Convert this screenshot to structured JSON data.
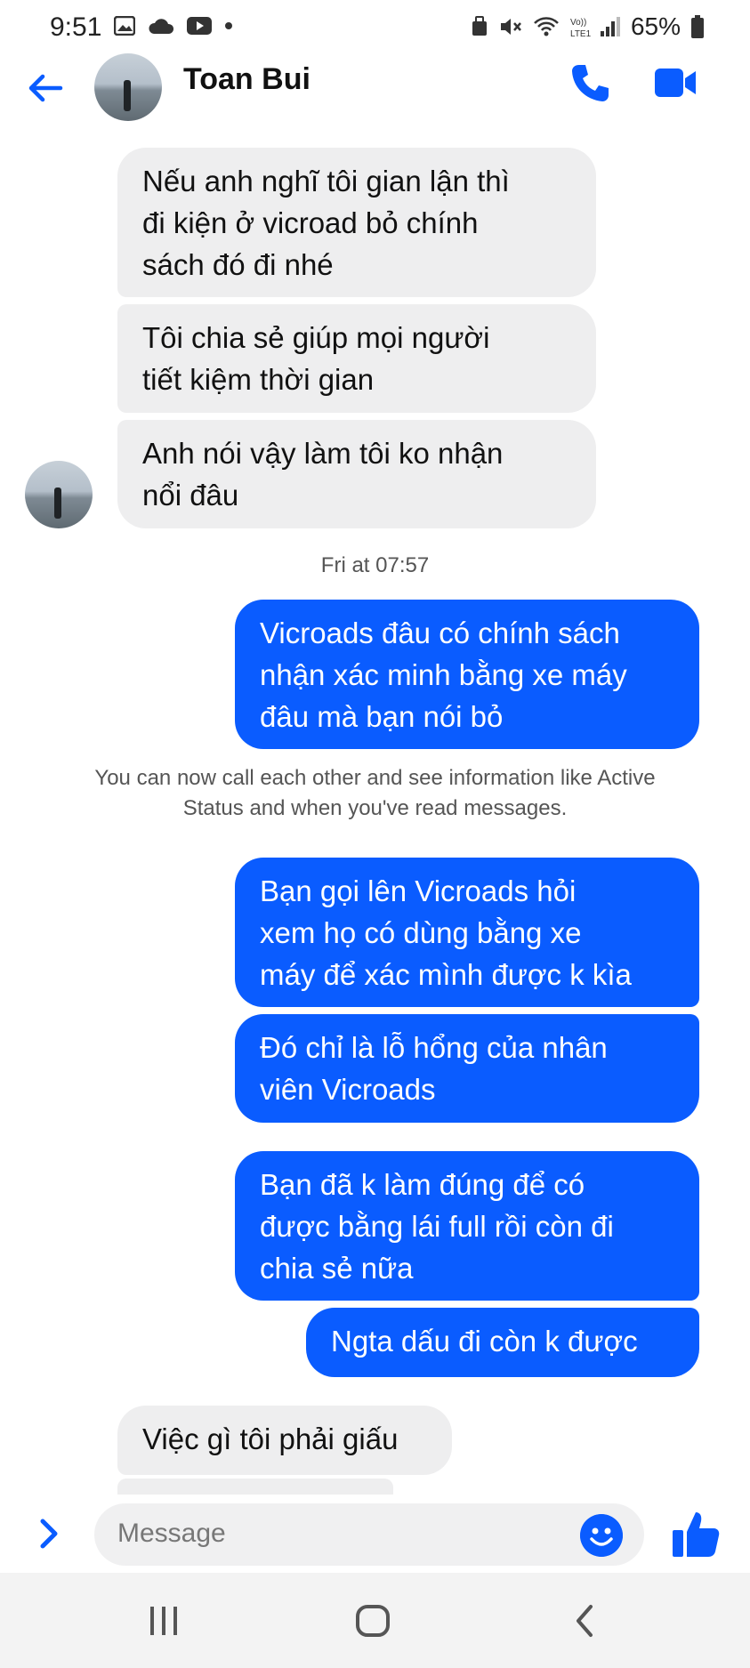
{
  "status_bar": {
    "time": "9:51",
    "battery": "65%"
  },
  "contact": {
    "name": "Toan Bui"
  },
  "messages": [
    {
      "dir": "in",
      "lines": [
        "Nếu anh nghĩ tôi gian lận thì",
        "đi kiện ở vicroad bỏ chính",
        "sách đó đi nhé"
      ]
    },
    {
      "dir": "in",
      "lines": [
        "Tôi chia sẻ giúp mọi người",
        "tiết kiệm thời gian"
      ]
    },
    {
      "dir": "in",
      "lines": [
        "Anh nói vậy làm tôi ko nhận",
        "nổi đâu"
      ]
    },
    {
      "dir": "out",
      "lines": [
        "Vicroads đâu có chính sách",
        "nhận xác minh bằng xe máy",
        "đâu mà bạn nói bỏ"
      ]
    },
    {
      "dir": "out",
      "lines": [
        "Bạn gọi lên Vicroads hỏi",
        "xem họ có dùng bằng xe",
        "máy để xác mình được k kìa"
      ]
    },
    {
      "dir": "out",
      "lines": [
        "Đó chỉ là lỗ hổng của nhân",
        "viên Vicroads"
      ]
    },
    {
      "dir": "out",
      "lines": [
        "Bạn đã k làm đúng để có",
        "được bằng lái full rồi còn đi",
        "chia sẻ nữa"
      ]
    },
    {
      "dir": "out",
      "lines": [
        "Ngta dấu đi còn k được"
      ]
    },
    {
      "dir": "in",
      "lines": [
        "Việc gì tôi phải giấu"
      ]
    }
  ],
  "timestamp": "Fri at 07:57",
  "notice": [
    "You can now call each other and see information like Active",
    "Status and when you've read messages."
  ],
  "composer": {
    "placeholder": "Message"
  },
  "colors": {
    "accent": "#0a5cff",
    "incoming": "#eeeeef"
  },
  "icons": [
    "back-arrow-icon",
    "phone-icon",
    "video-icon",
    "chevron-right-icon",
    "emoji-icon",
    "thumbs-up-icon",
    "recent-apps-icon",
    "home-icon",
    "back-icon"
  ]
}
